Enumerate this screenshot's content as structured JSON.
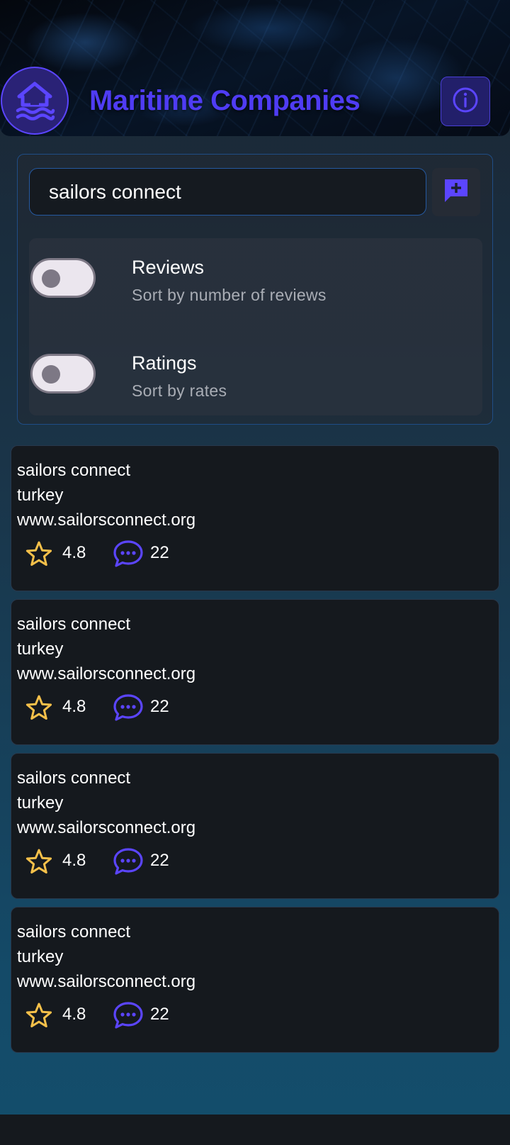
{
  "header": {
    "title": "Maritime Companies",
    "logo_icon": "house-waves-icon",
    "info_icon": "info-circle-icon"
  },
  "search": {
    "value": "sailors connect",
    "add_icon": "add-comment-icon"
  },
  "sort": {
    "reviews": {
      "title": "Reviews",
      "subtitle": "Sort by number of reviews",
      "enabled": false
    },
    "ratings": {
      "title": "Ratings",
      "subtitle": "Sort by rates",
      "enabled": false
    }
  },
  "companies": [
    {
      "name": "sailors connect",
      "country": "turkey",
      "website": "www.sailorsconnect.org",
      "rating": "4.8",
      "reviews": "22"
    },
    {
      "name": "sailors connect",
      "country": "turkey",
      "website": "www.sailorsconnect.org",
      "rating": "4.8",
      "reviews": "22"
    },
    {
      "name": "sailors connect",
      "country": "turkey",
      "website": "www.sailorsconnect.org",
      "rating": "4.8",
      "reviews": "22"
    },
    {
      "name": "sailors connect",
      "country": "turkey",
      "website": "www.sailorsconnect.org",
      "rating": "4.8",
      "reviews": "22"
    }
  ],
  "colors": {
    "accent": "#4f3cf4",
    "star": "#f5c04a",
    "card_bg": "#15191e"
  }
}
